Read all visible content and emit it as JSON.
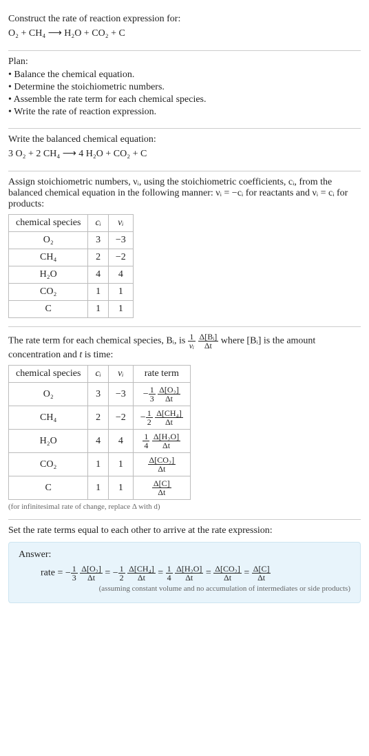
{
  "title": "Construct the rate of reaction expression for:",
  "unbalanced_eq": "O₂ + CH₄ ⟶ H₂O + CO₂ + C",
  "plan_heading": "Plan:",
  "plan_items": [
    "• Balance the chemical equation.",
    "• Determine the stoichiometric numbers.",
    "• Assemble the rate term for each chemical species.",
    "• Write the rate of reaction expression."
  ],
  "balanced_heading": "Write the balanced chemical equation:",
  "balanced_eq": "3 O₂ + 2 CH₄ ⟶ 4 H₂O + CO₂ + C",
  "stoich_intro": "Assign stoichiometric numbers, νᵢ, using the stoichiometric coefficients, cᵢ, from the balanced chemical equation in the following manner: νᵢ = −cᵢ for reactants and νᵢ = cᵢ for products:",
  "stoich_table": {
    "headers": [
      "chemical species",
      "cᵢ",
      "νᵢ"
    ],
    "rows": [
      [
        "O₂",
        "3",
        "−3"
      ],
      [
        "CH₄",
        "2",
        "−2"
      ],
      [
        "H₂O",
        "4",
        "4"
      ],
      [
        "CO₂",
        "1",
        "1"
      ],
      [
        "C",
        "1",
        "1"
      ]
    ]
  },
  "rate_intro_a": "The rate term for each chemical species, Bᵢ, is ",
  "rate_frac_num": "1",
  "rate_frac_den": "νᵢ",
  "rate_frac2_num": "Δ[Bᵢ]",
  "rate_frac2_den": "Δt",
  "rate_intro_b": " where [Bᵢ] is the amount concentration and ",
  "rate_intro_c": "t",
  "rate_intro_d": " is time:",
  "rate_table": {
    "headers": [
      "chemical species",
      "cᵢ",
      "νᵢ",
      "rate term"
    ],
    "rows": [
      {
        "sp": "O₂",
        "c": "3",
        "v": "−3",
        "neg": "−",
        "fn": "1",
        "fd": "3",
        "dn": "Δ[O₂]",
        "dd": "Δt"
      },
      {
        "sp": "CH₄",
        "c": "2",
        "v": "−2",
        "neg": "−",
        "fn": "1",
        "fd": "2",
        "dn": "Δ[CH₄]",
        "dd": "Δt"
      },
      {
        "sp": "H₂O",
        "c": "4",
        "v": "4",
        "neg": "",
        "fn": "1",
        "fd": "4",
        "dn": "Δ[H₂O]",
        "dd": "Δt"
      },
      {
        "sp": "CO₂",
        "c": "1",
        "v": "1",
        "neg": "",
        "fn": "",
        "fd": "",
        "dn": "Δ[CO₂]",
        "dd": "Δt"
      },
      {
        "sp": "C",
        "c": "1",
        "v": "1",
        "neg": "",
        "fn": "",
        "fd": "",
        "dn": "Δ[C]",
        "dd": "Δt"
      }
    ]
  },
  "infinitesimal_note": "(for infinitesimal rate of change, replace Δ with d)",
  "set_equal": "Set the rate terms equal to each other to arrive at the rate expression:",
  "answer_label": "Answer:",
  "answer_eq": {
    "lhs": "rate = ",
    "terms": [
      {
        "neg": "−",
        "fn": "1",
        "fd": "3",
        "dn": "Δ[O₂]",
        "dd": "Δt"
      },
      {
        "neg": "−",
        "fn": "1",
        "fd": "2",
        "dn": "Δ[CH₄]",
        "dd": "Δt"
      },
      {
        "neg": "",
        "fn": "1",
        "fd": "4",
        "dn": "Δ[H₂O]",
        "dd": "Δt"
      },
      {
        "neg": "",
        "fn": "",
        "fd": "",
        "dn": "Δ[CO₂]",
        "dd": "Δt"
      },
      {
        "neg": "",
        "fn": "",
        "fd": "",
        "dn": "Δ[C]",
        "dd": "Δt"
      }
    ]
  },
  "assumption_note": "(assuming constant volume and no accumulation of intermediates or side products)",
  "chart_data": {
    "type": "table",
    "tables": [
      {
        "title": "stoichiometric numbers",
        "columns": [
          "chemical species",
          "c_i",
          "ν_i"
        ],
        "rows": [
          [
            "O2",
            3,
            -3
          ],
          [
            "CH4",
            2,
            -2
          ],
          [
            "H2O",
            4,
            4
          ],
          [
            "CO2",
            1,
            1
          ],
          [
            "C",
            1,
            1
          ]
        ]
      },
      {
        "title": "rate terms",
        "columns": [
          "chemical species",
          "c_i",
          "ν_i",
          "rate term"
        ],
        "rows": [
          [
            "O2",
            3,
            -3,
            "-(1/3) Δ[O2]/Δt"
          ],
          [
            "CH4",
            2,
            -2,
            "-(1/2) Δ[CH4]/Δt"
          ],
          [
            "H2O",
            4,
            4,
            "(1/4) Δ[H2O]/Δt"
          ],
          [
            "CO2",
            1,
            1,
            "Δ[CO2]/Δt"
          ],
          [
            "C",
            1,
            1,
            "Δ[C]/Δt"
          ]
        ]
      }
    ]
  }
}
